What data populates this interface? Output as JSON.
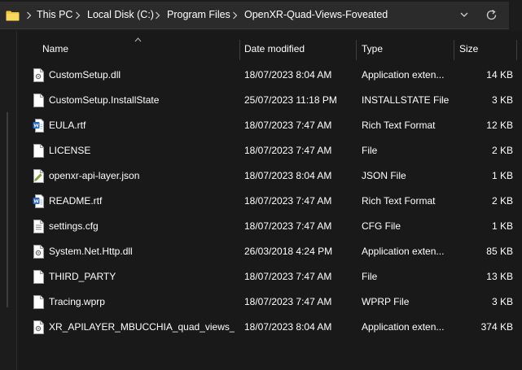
{
  "address_bar": {
    "breadcrumbs": [
      "This PC",
      "Local Disk (C:)",
      "Program Files",
      "OpenXR-Quad-Views-Foveated"
    ]
  },
  "columns": {
    "name": "Name",
    "date_modified": "Date modified",
    "type": "Type",
    "size": "Size"
  },
  "files": [
    {
      "name": "CustomSetup.dll",
      "date": "18/07/2023 8:04 AM",
      "type": "Application exten...",
      "size": "14 KB",
      "icon": "dll-file-icon"
    },
    {
      "name": "CustomSetup.InstallState",
      "date": "25/07/2023 11:18 PM",
      "type": "INSTALLSTATE File",
      "size": "3 KB",
      "icon": "generic-file-icon"
    },
    {
      "name": "EULA.rtf",
      "date": "18/07/2023 7:47 AM",
      "type": "Rich Text Format",
      "size": "12 KB",
      "icon": "word-document-icon"
    },
    {
      "name": "LICENSE",
      "date": "18/07/2023 7:47 AM",
      "type": "File",
      "size": "2 KB",
      "icon": "generic-file-icon"
    },
    {
      "name": "openxr-api-layer.json",
      "date": "18/07/2023 8:04 AM",
      "type": "JSON File",
      "size": "1 KB",
      "icon": "json-file-icon"
    },
    {
      "name": "README.rtf",
      "date": "18/07/2023 7:47 AM",
      "type": "Rich Text Format",
      "size": "2 KB",
      "icon": "word-document-icon"
    },
    {
      "name": "settings.cfg",
      "date": "18/07/2023 7:47 AM",
      "type": "CFG File",
      "size": "1 KB",
      "icon": "config-file-icon"
    },
    {
      "name": "System.Net.Http.dll",
      "date": "26/03/2018 4:24 PM",
      "type": "Application exten...",
      "size": "85 KB",
      "icon": "dll-file-icon"
    },
    {
      "name": "THIRD_PARTY",
      "date": "18/07/2023 7:47 AM",
      "type": "File",
      "size": "13 KB",
      "icon": "generic-file-icon"
    },
    {
      "name": "Tracing.wprp",
      "date": "18/07/2023 7:47 AM",
      "type": "WPRP File",
      "size": "3 KB",
      "icon": "generic-file-icon"
    },
    {
      "name": "XR_APILAYER_MBUCCHIA_quad_views_f...",
      "date": "18/07/2023 8:04 AM",
      "type": "Application exten...",
      "size": "374 KB",
      "icon": "dll-file-icon"
    }
  ],
  "colors": {
    "background": "#191919",
    "address_bar": "#2b2b2b",
    "text": "#ffffff",
    "folder_yellow": "#f3c93b",
    "word_blue": "#2b67c9",
    "json_green": "#8fb830"
  }
}
